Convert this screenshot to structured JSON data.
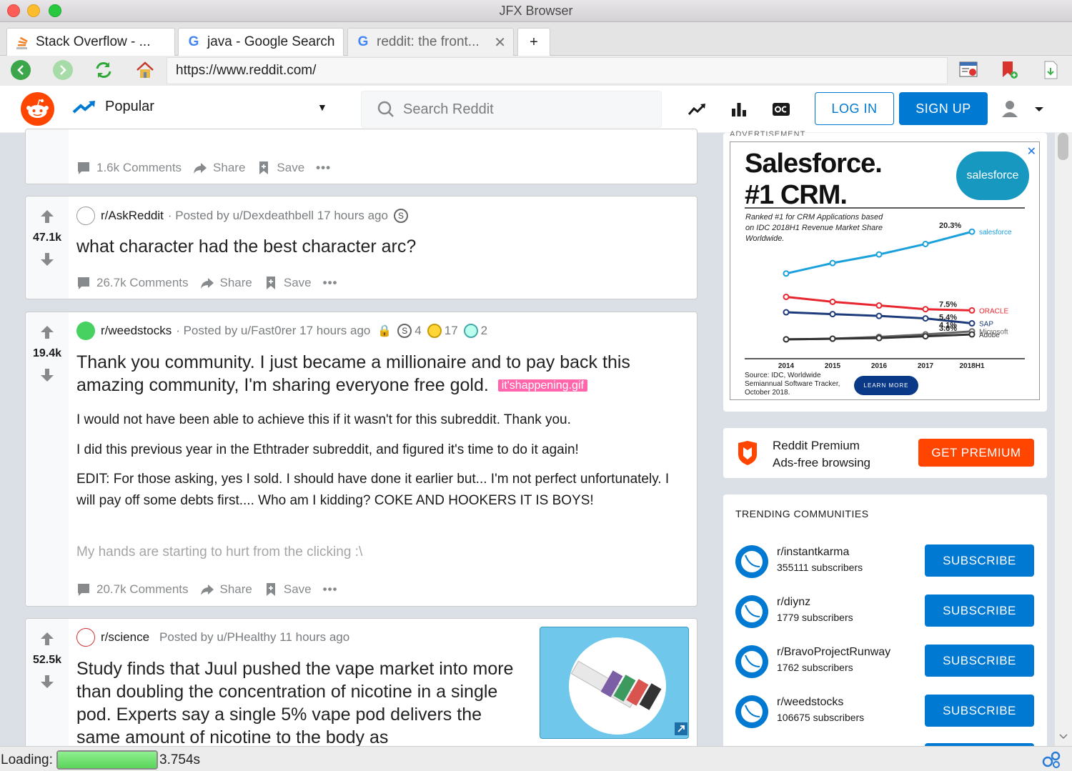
{
  "window": {
    "title": "JFX Browser"
  },
  "tabs": [
    {
      "label": "Stack Overflow - ..."
    },
    {
      "label": "java - Google Search"
    },
    {
      "label": "reddit: the front..."
    }
  ],
  "tab_new_label": "+",
  "tab_close_label": "✕",
  "nav": {
    "url": "https://www.reddit.com/"
  },
  "header": {
    "feed_label": "Popular",
    "search_placeholder": "Search Reddit",
    "login_label": "LOG IN",
    "signup_label": "SIGN UP"
  },
  "colors": {
    "accent": "#0079d3",
    "brand": "#ff4500",
    "flair": "#ff66ac"
  },
  "posts": [
    {
      "comments": "1.6k Comments",
      "share": "Share",
      "save": "Save"
    },
    {
      "votes": "47.1k",
      "subreddit": "r/AskReddit",
      "posted_by": "· Posted by u/Dexdeathbell 17 hours ago",
      "title": "what character had the best character arc?",
      "comments": "26.7k Comments",
      "share": "Share",
      "save": "Save"
    },
    {
      "votes": "19.4k",
      "subreddit": "r/weedstocks",
      "posted_by": "· Posted by u/Fast0rer 17 hours ago",
      "awards": [
        {
          "count": "4"
        },
        {
          "count": "17"
        },
        {
          "count": "2"
        }
      ],
      "title": "Thank you community. I just became a millionaire and to pay back this amazing community, I'm sharing everyone free gold.",
      "flair": "it'shappening.gif",
      "body": [
        "I would not have been able to achieve this if it wasn't for this subreddit. Thank you.",
        "I did this previous year in the Ethtrader subreddit, and figured it's time to do it again!",
        "EDIT: For those asking, yes I sold. I should have done it earlier but... I'm not perfect unfortunately. I will pay off some debts first.... Who am I kidding? COKE AND HOOKERS IT IS BOYS!"
      ],
      "body_faded": "My hands are starting to hurt from the clicking :\\",
      "comments": "20.7k Comments",
      "share": "Share",
      "save": "Save"
    },
    {
      "votes": "52.5k",
      "subreddit": "r/science",
      "posted_by": "Posted by u/PHealthy 11 hours ago",
      "title": "Study finds that Juul pushed the vape market into more than doubling the concentration of nicotine in a single pod. Experts say a single 5% vape pod delivers the same amount of nicotine to the body as"
    }
  ],
  "ad": {
    "label": "ADVERTISEMENT",
    "headline_1": "Salesforce.",
    "headline_2": "#1 CRM.",
    "logo_text": "salesforce",
    "caption": "Ranked #1 for CRM Applications based on IDC 2018H1 Revenue Market Share Worldwide.",
    "source": "Source: IDC, Worldwide Semiannual Software Tracker, October 2018.",
    "cta": "LEARN MORE",
    "close_label": "✕",
    "chart_data": {
      "type": "line",
      "x": [
        "2014",
        "2015",
        "2016",
        "2017",
        "2018H1"
      ],
      "series": [
        {
          "name": "salesforce",
          "values": [
            13.5,
            15.2,
            16.6,
            18.3,
            20.3
          ]
        },
        {
          "name": "ORACLE",
          "values": [
            9.7,
            8.9,
            8.3,
            7.7,
            7.5
          ]
        },
        {
          "name": "SAP",
          "values": [
            7.2,
            6.9,
            6.6,
            6.2,
            5.4
          ]
        },
        {
          "name": "Microsoft",
          "values": [
            2.8,
            2.9,
            3.2,
            3.6,
            4.1
          ]
        },
        {
          "name": "Adobe",
          "values": [
            2.8,
            2.9,
            3.0,
            3.3,
            3.6
          ]
        }
      ],
      "labels": [
        "20.3%",
        "7.5%",
        "5.4%",
        "4.1%",
        "3.6%"
      ],
      "ylim": [
        0,
        23
      ]
    }
  },
  "premium": {
    "title": "Reddit Premium",
    "subtitle": "Ads-free browsing",
    "cta": "GET PREMIUM"
  },
  "trending": {
    "heading": "TRENDING COMMUNITIES",
    "subscribe_label": "SUBSCRIBE",
    "items": [
      {
        "name": "r/instantkarma",
        "subs": "355111 subscribers"
      },
      {
        "name": "r/diynz",
        "subs": "1779 subscribers"
      },
      {
        "name": "r/BravoProjectRunway",
        "subs": "1762 subscribers"
      },
      {
        "name": "r/weedstocks",
        "subs": "106675 subscribers"
      }
    ]
  },
  "status": {
    "label": "Loading:",
    "progress": 1.0,
    "time": "3.754s"
  }
}
